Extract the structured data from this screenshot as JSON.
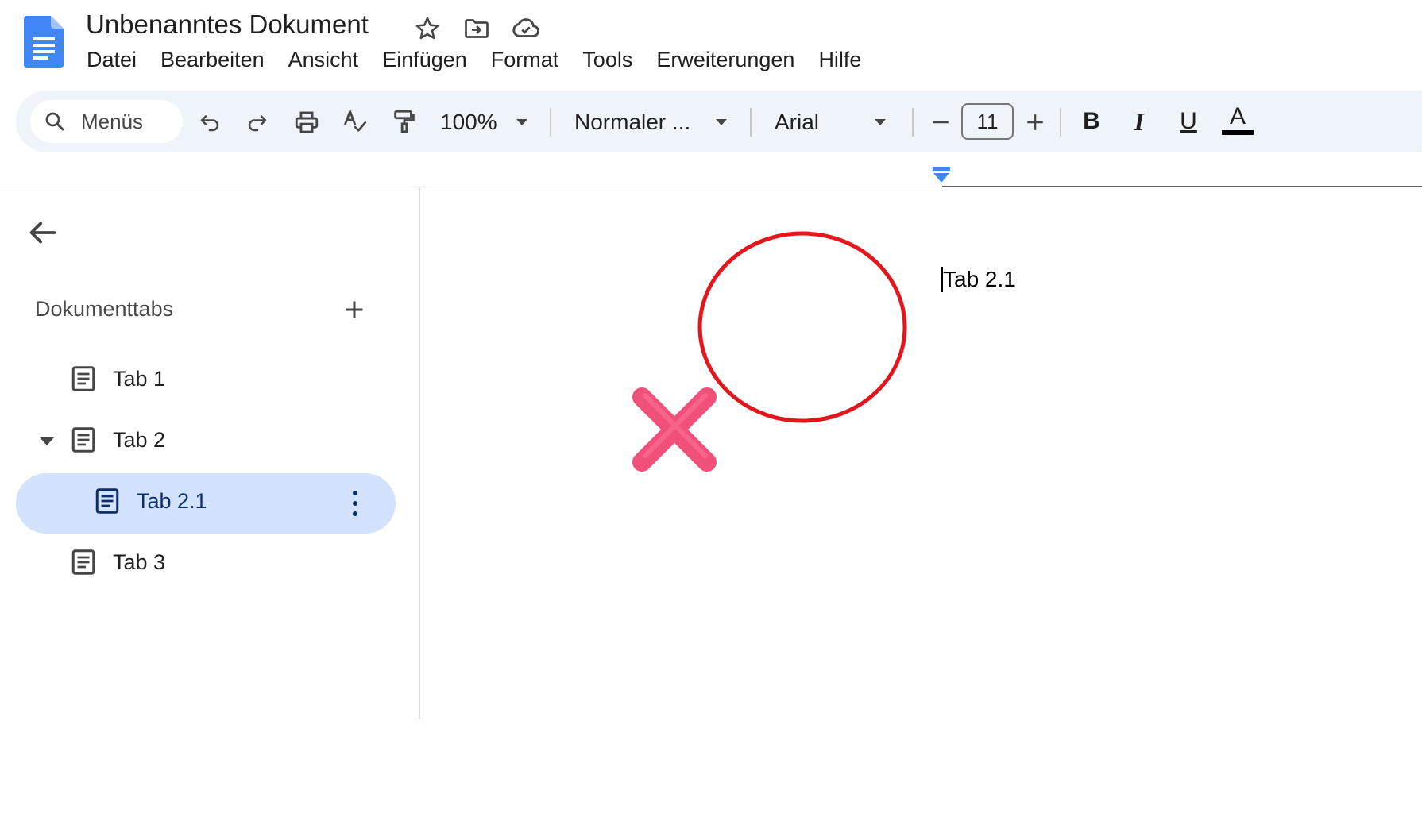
{
  "header": {
    "title": "Unbenanntes Dokument",
    "icons": [
      "star-icon",
      "move-to-folder-icon",
      "cloud-saved-icon"
    ],
    "logo": "google-docs-logo",
    "brand_color": "#4285f4"
  },
  "menubar": {
    "items": [
      "Datei",
      "Bearbeiten",
      "Ansicht",
      "Einfügen",
      "Format",
      "Tools",
      "Erweiterungen",
      "Hilfe"
    ]
  },
  "toolbar": {
    "search_label": "Menüs",
    "zoom": "100%",
    "style": "Normaler ...",
    "font": "Arial",
    "font_size": "11",
    "bold_label": "B",
    "italic_label": "I",
    "underline_label": "U",
    "text_color_label": "A",
    "background_color": "#eff3fa"
  },
  "sidebar": {
    "heading": "Dokumenttabs",
    "tabs": [
      {
        "label": "Tab 1",
        "level": 0,
        "selected": false
      },
      {
        "label": "Tab 2",
        "level": 0,
        "selected": false,
        "expanded": true
      },
      {
        "label": "Tab 2.1",
        "level": 1,
        "selected": true
      },
      {
        "label": "Tab 3",
        "level": 0,
        "selected": false
      }
    ],
    "selected_color": "#d3e3fd"
  },
  "document": {
    "text": "Tab 2.1"
  },
  "annotations": {
    "circle_color": "#e3161c",
    "cross_color": "#f0507a"
  }
}
